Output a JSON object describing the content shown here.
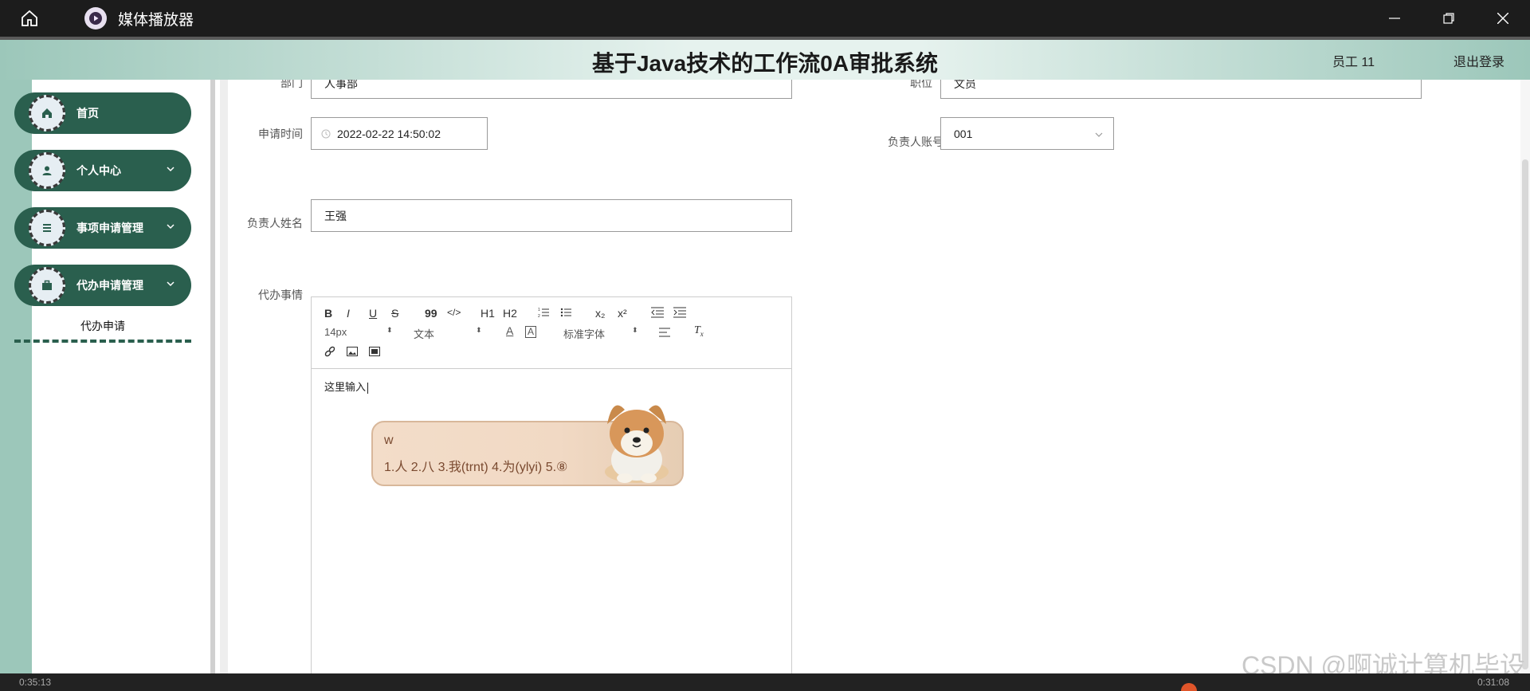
{
  "window": {
    "app_title": "媒体播放器",
    "icons": [
      "home-icon",
      "play-icon",
      "minimize-icon",
      "restore-icon",
      "close-icon"
    ]
  },
  "header": {
    "title": "基于Java技术的工作流0A审批系统",
    "user": "员工 11",
    "logout": "退出登录"
  },
  "sidebar": {
    "items": [
      {
        "label": "首页",
        "icon": "home-icon",
        "has_chevron": false
      },
      {
        "label": "个人中心",
        "icon": "person-icon",
        "has_chevron": true
      },
      {
        "label": "事项申请管理",
        "icon": "list-icon",
        "has_chevron": true
      },
      {
        "label": "代办申请管理",
        "icon": "briefcase-icon",
        "has_chevron": true
      }
    ],
    "sub_item": "代办申请"
  },
  "form": {
    "dept_label": "部门",
    "dept_value": "人事部",
    "position_label": "职位",
    "position_value": "文员",
    "time_label": "申请时间",
    "time_value": "2022-02-22 14:50:02",
    "manager_account_label": "负责人账号",
    "manager_account_value": "001",
    "manager_name_label": "负责人姓名",
    "manager_name_value": "王强",
    "todo_label": "代办事情"
  },
  "editor": {
    "toolbar_row1": [
      "B",
      "I",
      "U",
      "S",
      "99",
      "</>",
      "H1",
      "H2",
      "ol",
      "ul",
      "x₂",
      "x²",
      "outdent",
      "indent"
    ],
    "font_size": "14px",
    "block_type": "文本",
    "font_family": "标准字体",
    "content": "这里输入"
  },
  "ime": {
    "typed": "w",
    "candidates": "1.人  2.八  3.我(trnt)  4.为(ylyi)  5.⑧"
  },
  "watermark": "CSDN @啊诚计算机毕设",
  "player": {
    "elapsed": "0:35:13",
    "total": "0:31:08"
  },
  "colors": {
    "accent": "#2a5f4e",
    "header_bg": "#9cc7ba"
  }
}
